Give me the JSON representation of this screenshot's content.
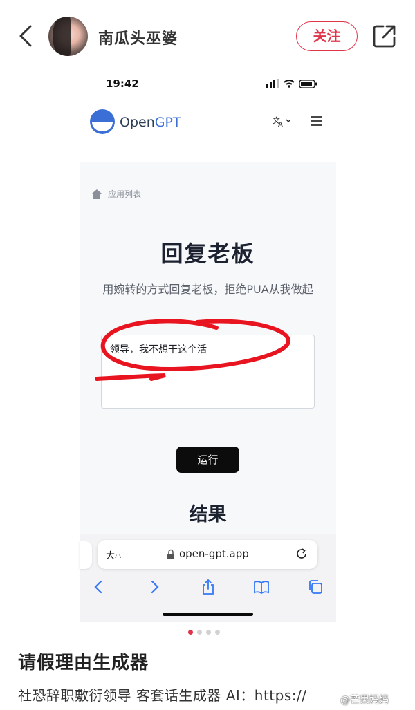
{
  "header": {
    "username": "南瓜头巫婆",
    "follow_label": "关注",
    "accent_color": "#e0344b",
    "icons": [
      "back-arrow-icon",
      "share-external-icon"
    ]
  },
  "screenshot": {
    "status_time": "19:42",
    "site": {
      "logo_text_open": "Open",
      "logo_text_gpt": "GPT",
      "translate_icon": "translate-icon",
      "menu_icon": "hamburger-menu-icon"
    },
    "breadcrumb": "应用列表",
    "page_title": "回复老板",
    "subtitle": "用婉转的方式回复老板，拒绝PUA从我做起",
    "input_value": "领导，我不想干这个活",
    "run_label": "运行",
    "result_title": "结果",
    "browser": {
      "text_size_big": "大",
      "text_size_small": "小",
      "url": "open-gpt.app"
    }
  },
  "pager": {
    "count": 4,
    "active_index": 0
  },
  "post": {
    "title": "请假理由生成器",
    "body": "社恐辞职敷衍领导 客套话生成器 AI：https://",
    "watermark": "@芒果妈妈"
  }
}
